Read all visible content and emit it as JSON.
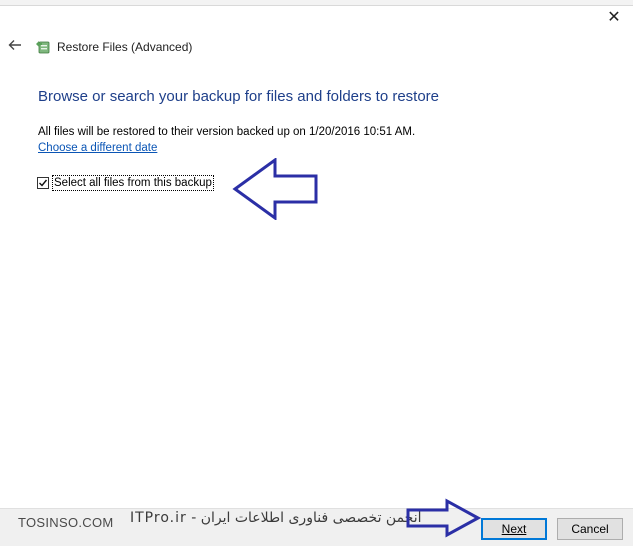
{
  "window": {
    "title": "Restore Files (Advanced)",
    "close_symbol": "✕",
    "back_symbol": "🡐",
    "icon": "restore-files-icon"
  },
  "main": {
    "heading": "Browse or search your backup for files and folders to restore",
    "info_text": "All files will be restored to their version backed up on 1/20/2016 10:51 AM.",
    "change_date_link": "Choose a different date",
    "select_all": {
      "label": "Select all files from this backup",
      "checked": true
    }
  },
  "annotations": {
    "arrow_color": "#2b2fa6"
  },
  "watermark": {
    "site": "TOSINSO.COM",
    "persian_text": "انجمن تخصصی فناوری اطلاعات ایران - ITPro.ir"
  },
  "buttons": {
    "next": "Next",
    "cancel": "Cancel"
  }
}
